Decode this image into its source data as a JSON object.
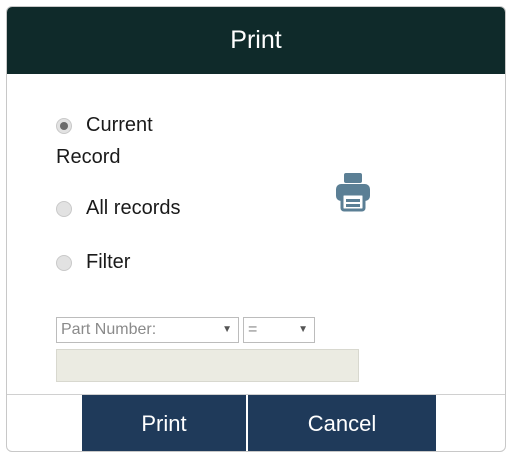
{
  "dialog": {
    "title": "Print"
  },
  "options": {
    "current_record_part1": "Current",
    "current_record_part2": "Record",
    "all_records": "All records",
    "filter": "Filter",
    "selected": "current_record"
  },
  "filter_controls": {
    "field_select_value": "Part Number:",
    "operator_select_value": "=",
    "value_input": ""
  },
  "buttons": {
    "print": "Print",
    "cancel": "Cancel"
  },
  "colors": {
    "titlebar": "#0f2a2a",
    "buttons": "#1f3a5a",
    "printer_icon": "#5b7f95"
  },
  "icons": {
    "printer": "printer-icon",
    "select_arrow": "dropdown-arrow-icon"
  }
}
